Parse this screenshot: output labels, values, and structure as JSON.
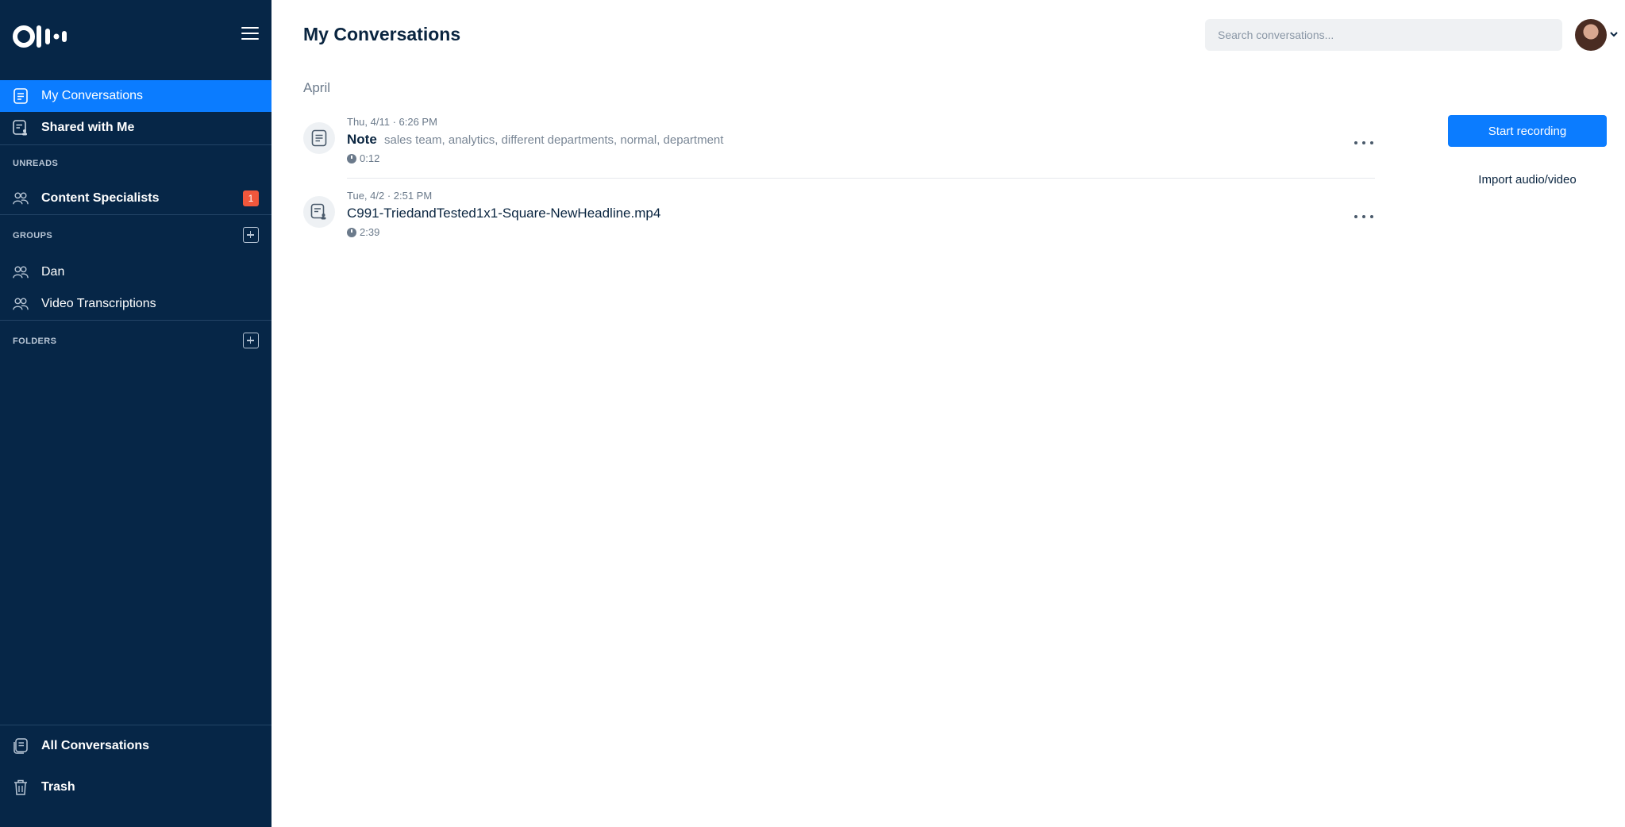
{
  "app": {
    "logo_icon": "otter-logo-icon"
  },
  "sidebar": {
    "menu_icon": "hamburger-menu-icon",
    "nav": [
      {
        "label": "My Conversations",
        "icon": "conversations-icon",
        "active": true
      },
      {
        "label": "Shared with Me",
        "icon": "shared-icon",
        "active": false
      }
    ],
    "unreads_label": "UNREADS",
    "unreads": [
      {
        "label": "Content Specialists",
        "count": "1",
        "icon": "group-icon"
      }
    ],
    "groups_label": "GROUPS",
    "groups": [
      {
        "label": "Dan",
        "icon": "group-icon"
      },
      {
        "label": "Video Transcriptions",
        "icon": "group-icon"
      }
    ],
    "folders_label": "FOLDERS",
    "bottom": [
      {
        "label": "All Conversations",
        "icon": "all-conversations-icon"
      },
      {
        "label": "Trash",
        "icon": "trash-icon"
      }
    ]
  },
  "header": {
    "title": "My Conversations",
    "search_placeholder": "Search conversations...",
    "search_value": ""
  },
  "main": {
    "month": "April",
    "conversations": [
      {
        "date": "Thu, 4/11 · 6:26 PM",
        "title": "Note",
        "keywords": "sales team, analytics, different departments, normal, department",
        "duration": "0:12",
        "icon": "note-icon"
      },
      {
        "date": "Tue, 4/2 · 2:51 PM",
        "title": "C991-TriedandTested1x1-Square-NewHeadline.mp4",
        "keywords": "",
        "duration": "2:39",
        "icon": "shared-note-icon"
      }
    ]
  },
  "actions": {
    "start_recording": "Start recording",
    "import": "Import audio/video"
  },
  "colors": {
    "sidebar_bg": "#062647",
    "accent": "#0b7cff",
    "badge": "#f0573c"
  }
}
